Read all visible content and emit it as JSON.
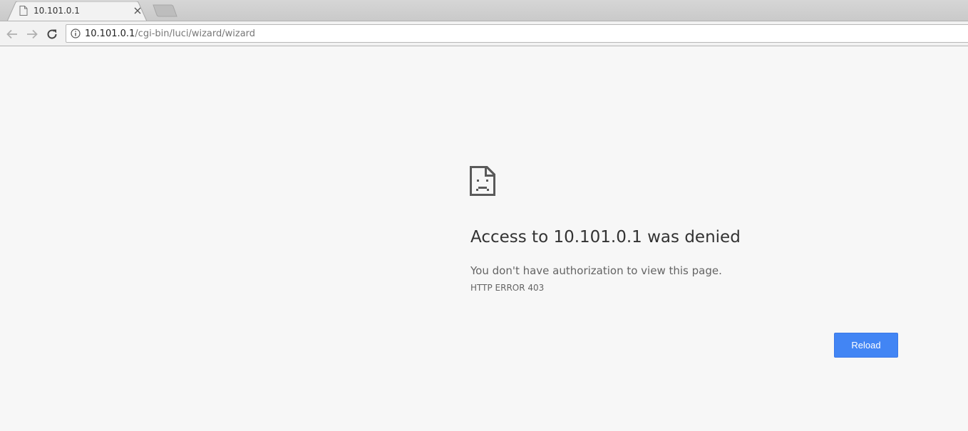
{
  "browser": {
    "tab": {
      "title": "10.101.0.1",
      "favicon": "page-icon"
    },
    "toolbar": {
      "back_icon": "arrow-left-icon",
      "forward_icon": "arrow-right-icon",
      "reload_icon": "reload-icon"
    },
    "omnibox": {
      "security_icon": "info-icon",
      "url_host": "10.101.0.1",
      "url_path": "/cgi-bin/luci/wizard/wizard"
    }
  },
  "error_page": {
    "icon": "sad-page-icon",
    "heading": "Access to 10.101.0.1 was denied",
    "message": "You don't have authorization to view this page.",
    "error_code": "HTTP ERROR 403",
    "reload_label": "Reload"
  },
  "colors": {
    "accent": "#4285f4",
    "page_background": "#f7f7f7"
  }
}
